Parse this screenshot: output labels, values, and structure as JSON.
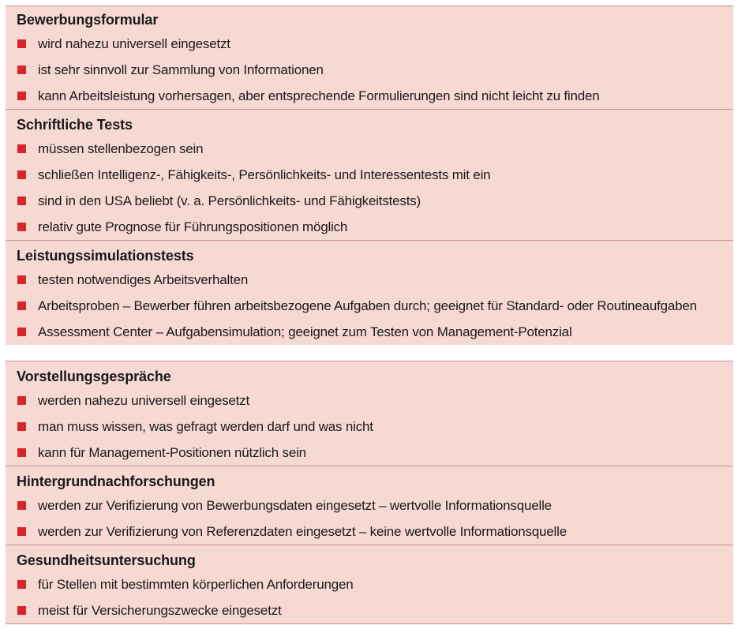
{
  "groups": [
    {
      "sections": [
        {
          "title": "Bewerbungsformular",
          "items": [
            "wird nahezu universell eingesetzt",
            "ist sehr sinnvoll zur Sammlung von Informationen",
            "kann Arbeitsleistung vorhersagen, aber entsprechende Formulierungen sind nicht leicht zu finden"
          ]
        },
        {
          "title": "Schriftliche Tests",
          "items": [
            "müssen stellenbezogen sein",
            "schließen Intelligenz-, Fähigkeits-, Persönlichkeits- und Interessentests mit ein",
            "sind in den USA beliebt (v. a. Persönlichkeits- und Fähigkeitstests)",
            "relativ gute Prognose für Führungspositionen möglich"
          ]
        },
        {
          "title": "Leistungssimulationstests",
          "items": [
            "testen notwendiges Arbeitsverhalten",
            "Arbeitsproben – Bewerber führen arbeitsbezogene Aufgaben durch; geeignet für Standard- oder Routineaufgaben",
            "Assessment Center – Aufgabensimulation; geeignet zum Testen von Management-Potenzial"
          ]
        }
      ]
    },
    {
      "sections": [
        {
          "title": "Vorstellungsgespräche",
          "items": [
            "werden nahezu universell eingesetzt",
            "man muss wissen, was gefragt werden darf und was nicht",
            "kann für Management-Positionen nützlich sein"
          ]
        },
        {
          "title": "Hintergrundnachforschungen",
          "items": [
            "werden zur Verifizierung von Bewerbungsdaten eingesetzt – wertvolle Informationsquelle",
            "werden zur Verifizierung von Referenzdaten eingesetzt – keine wertvolle Informationsquelle"
          ]
        },
        {
          "title": "Gesundheitsuntersuchung",
          "items": [
            "für Stellen mit bestimmten körperlichen Anforderungen",
            "meist für Versicherungszwecke eingesetzt"
          ]
        }
      ]
    }
  ],
  "colors": {
    "panel_background": "#f7d9d4",
    "divider": "#c98f88",
    "bullet": "#d7262b"
  }
}
